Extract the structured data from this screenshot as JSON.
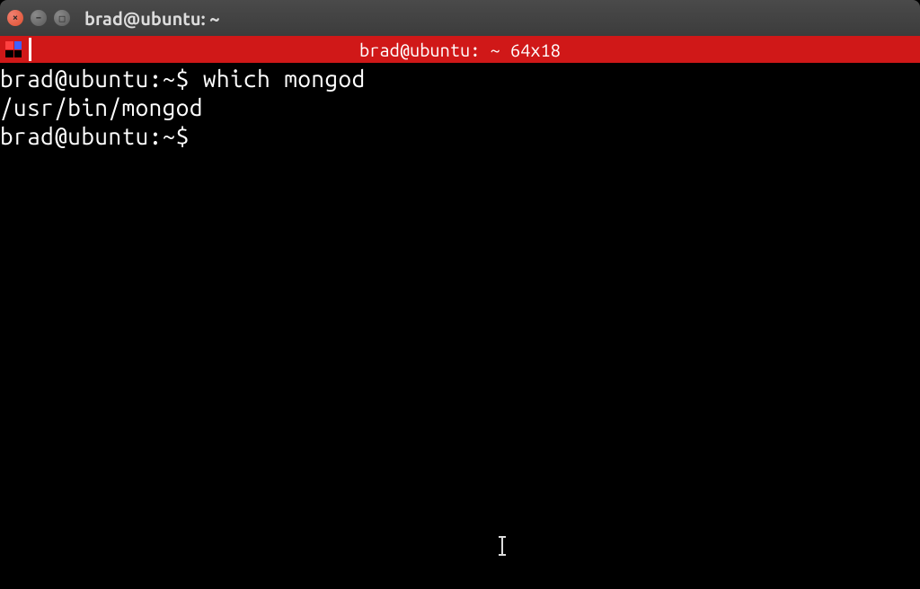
{
  "window": {
    "title": "brad@ubuntu: ~"
  },
  "tab": {
    "title": "brad@ubuntu: ~ 64x18"
  },
  "terminal": {
    "lines": [
      {
        "prompt": "brad@ubuntu:~$ ",
        "cmd": "which mongod"
      },
      {
        "output": "/usr/bin/mongod"
      },
      {
        "prompt": "brad@ubuntu:~$ ",
        "cmd": ""
      }
    ]
  }
}
